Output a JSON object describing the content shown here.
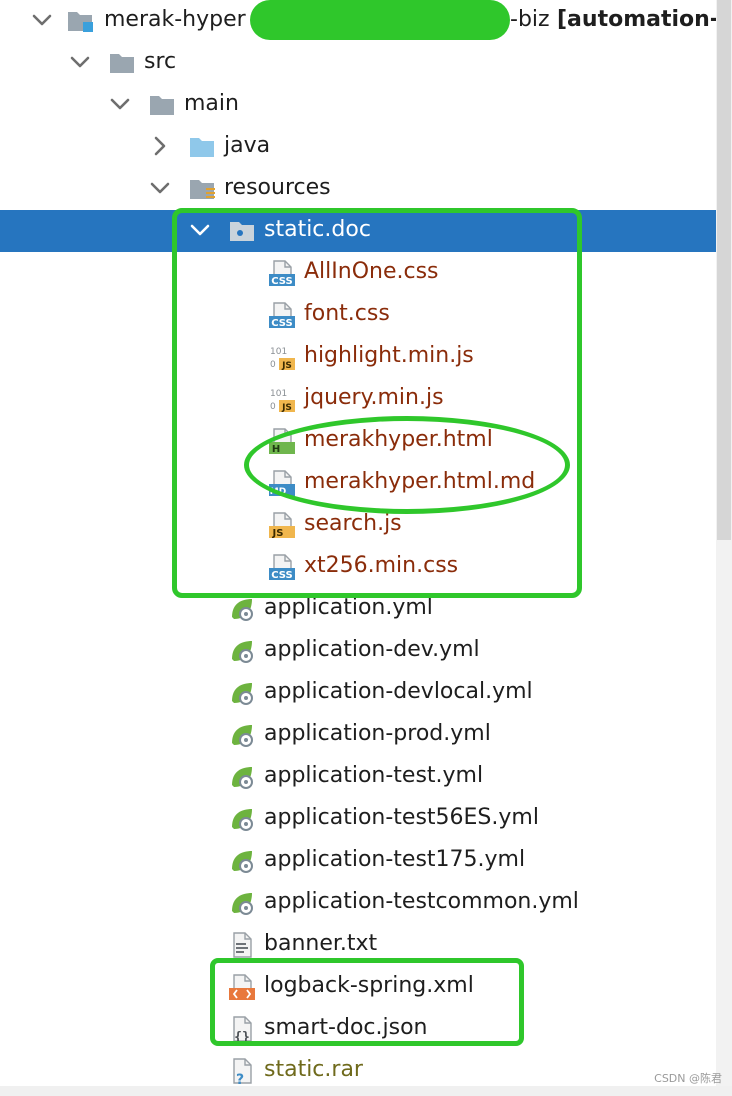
{
  "tree": {
    "root": {
      "label_prefix": "merak-hyper",
      "label_suffix": "-biz",
      "label_module": "[automation-"
    },
    "src": {
      "label": "src"
    },
    "main": {
      "label": "main"
    },
    "java": {
      "label": "java"
    },
    "resources": {
      "label": "resources"
    },
    "static_doc": {
      "label": "static.doc"
    },
    "static_files": [
      {
        "label": "AllInOne.css",
        "type": "css"
      },
      {
        "label": "font.css",
        "type": "css"
      },
      {
        "label": "highlight.min.js",
        "type": "minjs"
      },
      {
        "label": "jquery.min.js",
        "type": "minjs"
      },
      {
        "label": "merakhyper.html",
        "type": "html"
      },
      {
        "label": "merakhyper.html.md",
        "type": "md"
      },
      {
        "label": "search.js",
        "type": "js"
      },
      {
        "label": "xt256.min.css",
        "type": "css"
      }
    ],
    "yml_files": [
      {
        "label": "application.yml"
      },
      {
        "label": "application-dev.yml"
      },
      {
        "label": "application-devlocal.yml"
      },
      {
        "label": "application-prod.yml"
      },
      {
        "label": "application-test.yml"
      },
      {
        "label": "application-test56ES.yml"
      },
      {
        "label": "application-test175.yml"
      },
      {
        "label": "application-testcommon.yml"
      }
    ],
    "other_files": [
      {
        "label": "banner.txt",
        "type": "txt"
      },
      {
        "label": "logback-spring.xml",
        "type": "xml"
      },
      {
        "label": "smart-doc.json",
        "type": "json"
      },
      {
        "label": "static.rar",
        "type": "unknown"
      }
    ]
  },
  "icons": {
    "badges": {
      "css": "CSS",
      "js": "JS",
      "html": "H",
      "md": "MD"
    },
    "minified_marks": [
      "101",
      "0"
    ]
  },
  "colors": {
    "selection": "#2675bf",
    "annotation": "#2fc72b",
    "modified_file_text": "#8a2c0a",
    "css_badge": "#3d8cc6",
    "js_badge": "#f0b64d",
    "html_badge": "#6fb64d",
    "spring_leaf": "#6db33f"
  },
  "watermark": "CSDN @陈君"
}
